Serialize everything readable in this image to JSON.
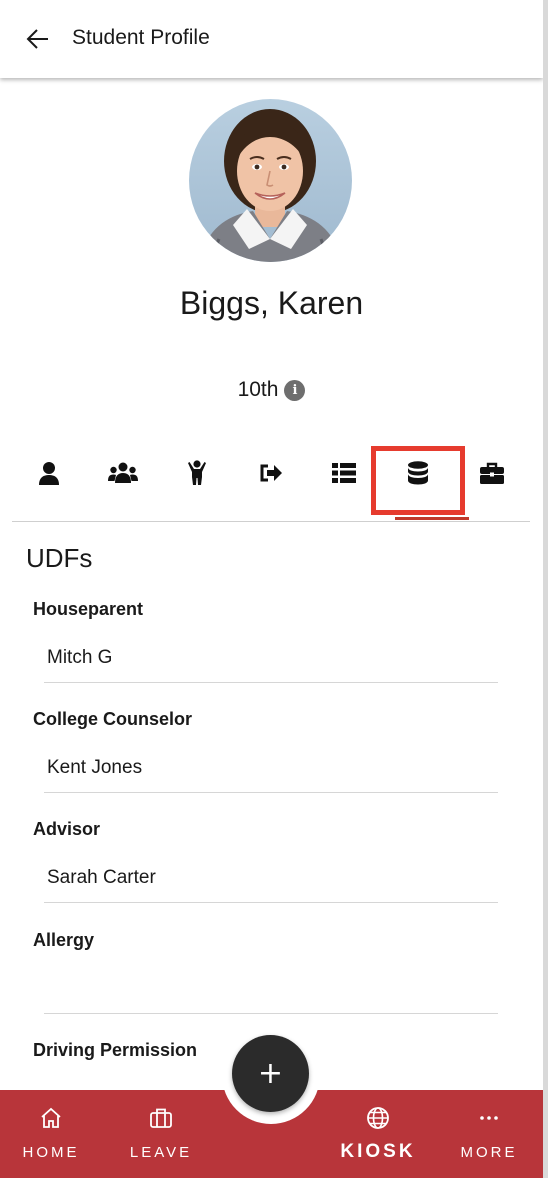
{
  "header": {
    "title": "Student Profile",
    "back_icon": "arrow-left-icon"
  },
  "profile": {
    "name": "Biggs, Karen",
    "grade": "10th",
    "grade_info_icon": "info-icon",
    "info_glyph": "i"
  },
  "tabs": [
    {
      "icon": "person-icon"
    },
    {
      "icon": "group-icon"
    },
    {
      "icon": "child-icon"
    },
    {
      "icon": "sign-out-icon"
    },
    {
      "icon": "list-icon"
    },
    {
      "icon": "database-icon",
      "active": true
    },
    {
      "icon": "briefcase-icon"
    }
  ],
  "udfs": {
    "title": "UDFs",
    "fields": [
      {
        "label": "Houseparent",
        "value": "Mitch G"
      },
      {
        "label": "College Counselor",
        "value": "Kent Jones"
      },
      {
        "label": "Advisor",
        "value": "Sarah Carter"
      },
      {
        "label": "Allergy",
        "value": ""
      },
      {
        "label": "Driving Permission",
        "value": ""
      }
    ]
  },
  "fab": {
    "icon": "plus-icon",
    "glyph": "+"
  },
  "bottom_nav": {
    "items": [
      {
        "label": "HOME",
        "icon": "home-icon"
      },
      {
        "label": "LEAVE",
        "icon": "suitcase-icon"
      },
      {
        "label": "KIOSK",
        "icon": "globe-icon"
      },
      {
        "label": "MORE",
        "icon": "more-icon"
      }
    ]
  },
  "colors": {
    "accent_red": "#b8353a",
    "highlight_box": "#e63b2e",
    "fab": "#2b2b2b"
  }
}
